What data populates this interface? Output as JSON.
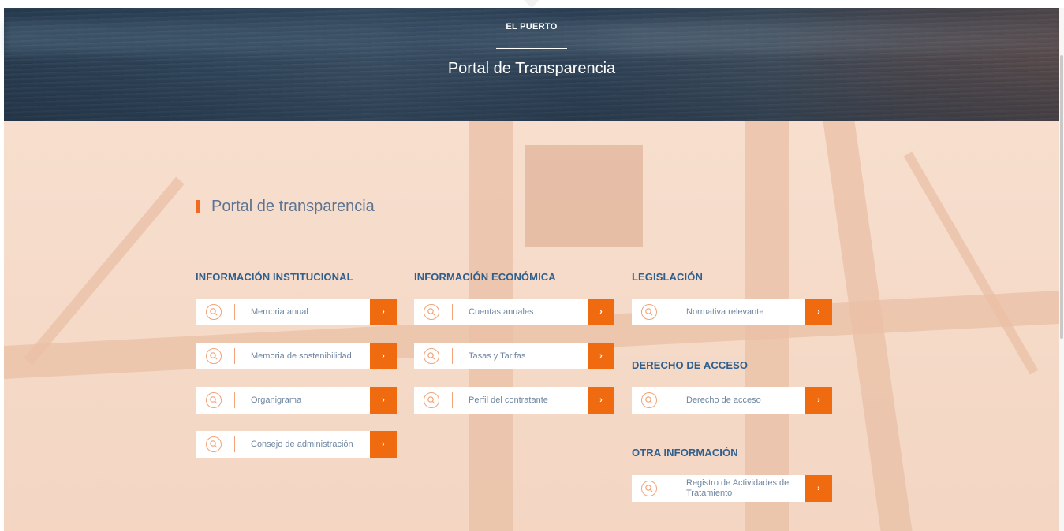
{
  "header": {
    "kicker": "EL PUERTO",
    "title": "Portal de Transparencia"
  },
  "section": {
    "title": "Portal de transparencia"
  },
  "columns": {
    "institucional": {
      "heading": "INFORMACIÓN INSTITUCIONAL",
      "items": [
        "Memoria anual",
        "Memoria de sostenibilidad",
        "Organigrama",
        "Consejo de administración"
      ]
    },
    "economica": {
      "heading": "INFORMACIÓN ECONÓMICA",
      "items": [
        "Cuentas anuales",
        "Tasas y Tarifas",
        "Perfil del contratante"
      ]
    },
    "legislacion": {
      "heading": "LEGISLACIÓN",
      "items": [
        "Normativa relevante"
      ]
    },
    "derecho": {
      "heading": "DERECHO DE ACCESO",
      "items": [
        "Derecho de acceso"
      ]
    },
    "otra": {
      "heading": "OTRA INFORMACIÓN",
      "items": [
        "Registro de Actividades de Tratamiento"
      ]
    }
  },
  "icons": {
    "item_icon": "search-icon",
    "arrow_icon": "chevron-right-icon",
    "arrow_glyph": "›"
  },
  "colors": {
    "accent": "#f06a0f",
    "heading": "#2f5f8d",
    "label": "#6f86a0"
  }
}
